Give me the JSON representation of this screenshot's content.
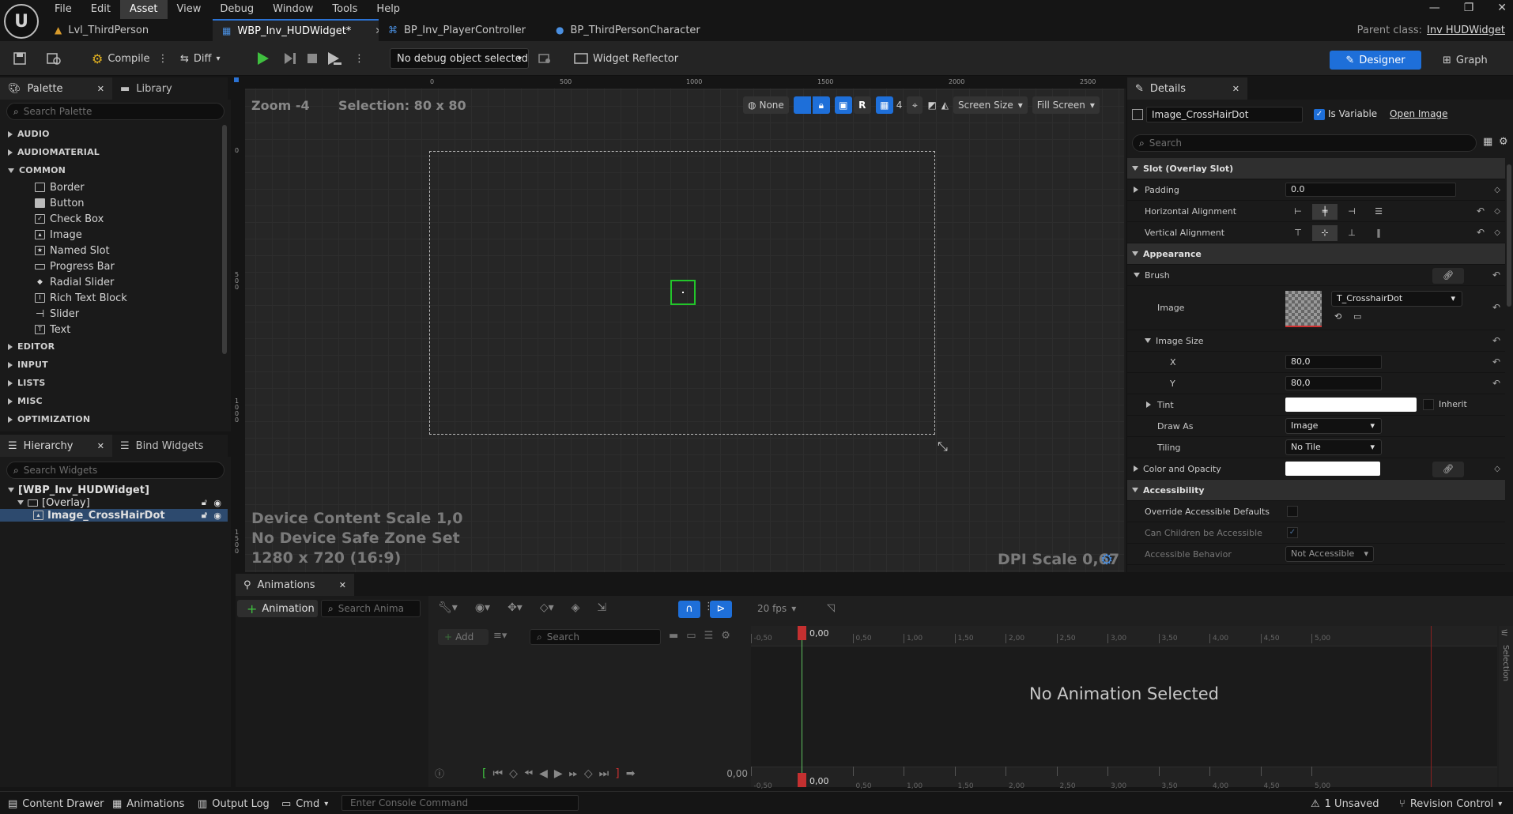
{
  "menu": [
    "File",
    "Edit",
    "Asset",
    "View",
    "Debug",
    "Window",
    "Tools",
    "Help"
  ],
  "active_menu": "Asset",
  "tabs": [
    {
      "label": "Lvl_ThirdPerson",
      "icon": "level-icon"
    },
    {
      "label": "WBP_Inv_HUDWidget*",
      "icon": "widget-blueprint-icon",
      "active": true
    },
    {
      "label": "BP_Inv_PlayerController",
      "icon": "controller-icon"
    },
    {
      "label": "BP_ThirdPersonCharacter",
      "icon": "character-icon"
    }
  ],
  "parent_class": {
    "label": "Parent class:",
    "value": "Inv HUDWidget"
  },
  "toolbar": {
    "compile": "Compile",
    "diff": "Diff",
    "debug_object": "No debug object selected",
    "widget_reflector": "Widget Reflector",
    "designer": "Designer",
    "graph": "Graph"
  },
  "palette": {
    "tab": "Palette",
    "library_tab": "Library",
    "search_placeholder": "Search Palette",
    "categories_top": [
      "AUDIO",
      "AUDIOMATERIAL",
      "COMMON"
    ],
    "common_items": [
      "Border",
      "Button",
      "Check Box",
      "Image",
      "Named Slot",
      "Progress Bar",
      "Radial Slider",
      "Rich Text Block",
      "Slider",
      "Text"
    ],
    "categories_bottom": [
      "EDITOR",
      "INPUT",
      "LISTS",
      "MISC",
      "OPTIMIZATION"
    ]
  },
  "hierarchy": {
    "tab": "Hierarchy",
    "bind_tab": "Bind Widgets",
    "search_placeholder": "Search Widgets",
    "items": [
      "[WBP_Inv_HUDWidget]",
      "[Overlay]",
      "Image_CrossHairDot"
    ]
  },
  "viewport": {
    "zoom": "Zoom -4",
    "selection": "Selection: 80 x 80",
    "none_label": "None",
    "r_label": "R",
    "grid_value": "4",
    "screen_size": "Screen Size",
    "fill_screen": "Fill Screen",
    "ruler_top": [
      "0",
      "500",
      "1000",
      "1500",
      "2000",
      "2500"
    ],
    "ruler_left": [
      "0",
      "500",
      "1000",
      "1500"
    ],
    "device_scale": "Device Content Scale 1,0",
    "safe_zone": "No Device Safe Zone Set",
    "resolution": "1280 x 720 (16:9)",
    "dpi": "DPI Scale 0,67"
  },
  "details": {
    "tab": "Details",
    "name": "Image_CrossHairDot",
    "is_variable_label": "Is Variable",
    "is_variable": true,
    "open_image": "Open Image",
    "search_placeholder": "Search",
    "slot_section": "Slot (Overlay Slot)",
    "padding_label": "Padding",
    "padding_value": "0.0",
    "h_align_label": "Horizontal Alignment",
    "v_align_label": "Vertical Alignment",
    "appearance_section": "Appearance",
    "brush_label": "Brush",
    "image_label": "Image",
    "image_asset": "T_CrosshairDot",
    "image_size_label": "Image Size",
    "x_label": "X",
    "x_value": "80,0",
    "y_label": "Y",
    "y_value": "80,0",
    "tint_label": "Tint",
    "inherit_label": "Inherit",
    "draw_as_label": "Draw As",
    "draw_as_value": "Image",
    "tiling_label": "Tiling",
    "tiling_value": "No Tile",
    "color_opacity_label": "Color and Opacity",
    "accessibility_section": "Accessibility",
    "override_label": "Override Accessible Defaults",
    "children_label": "Can Children be Accessible",
    "behavior_label": "Accessible Behavior",
    "behavior_value": "Not Accessible"
  },
  "animations": {
    "tab": "Animations",
    "add_animation": "Animation",
    "search_placeholder": "Search Anima",
    "add": "Add",
    "track_search": "Search",
    "fps": "20 fps",
    "time_labels": [
      "-0,50",
      "0,50",
      "1,00",
      "1,50",
      "2,00",
      "2,50",
      "3,00",
      "3,50",
      "4,00",
      "4,50",
      "5,00"
    ],
    "current_time": "0,00",
    "transport_time": "0,00",
    "empty_message": "No Animation Selected",
    "side_label": "Selection"
  },
  "statusbar": {
    "content_drawer": "Content Drawer",
    "animations": "Animations",
    "output_log": "Output Log",
    "cmd": "Cmd",
    "console_placeholder": "Enter Console Command",
    "unsaved": "1 Unsaved",
    "revision_control": "Revision Control"
  },
  "colors": {
    "accent": "#1e6fd9",
    "selection": "#2d4a6e",
    "widget_outline": "#22c52a"
  }
}
